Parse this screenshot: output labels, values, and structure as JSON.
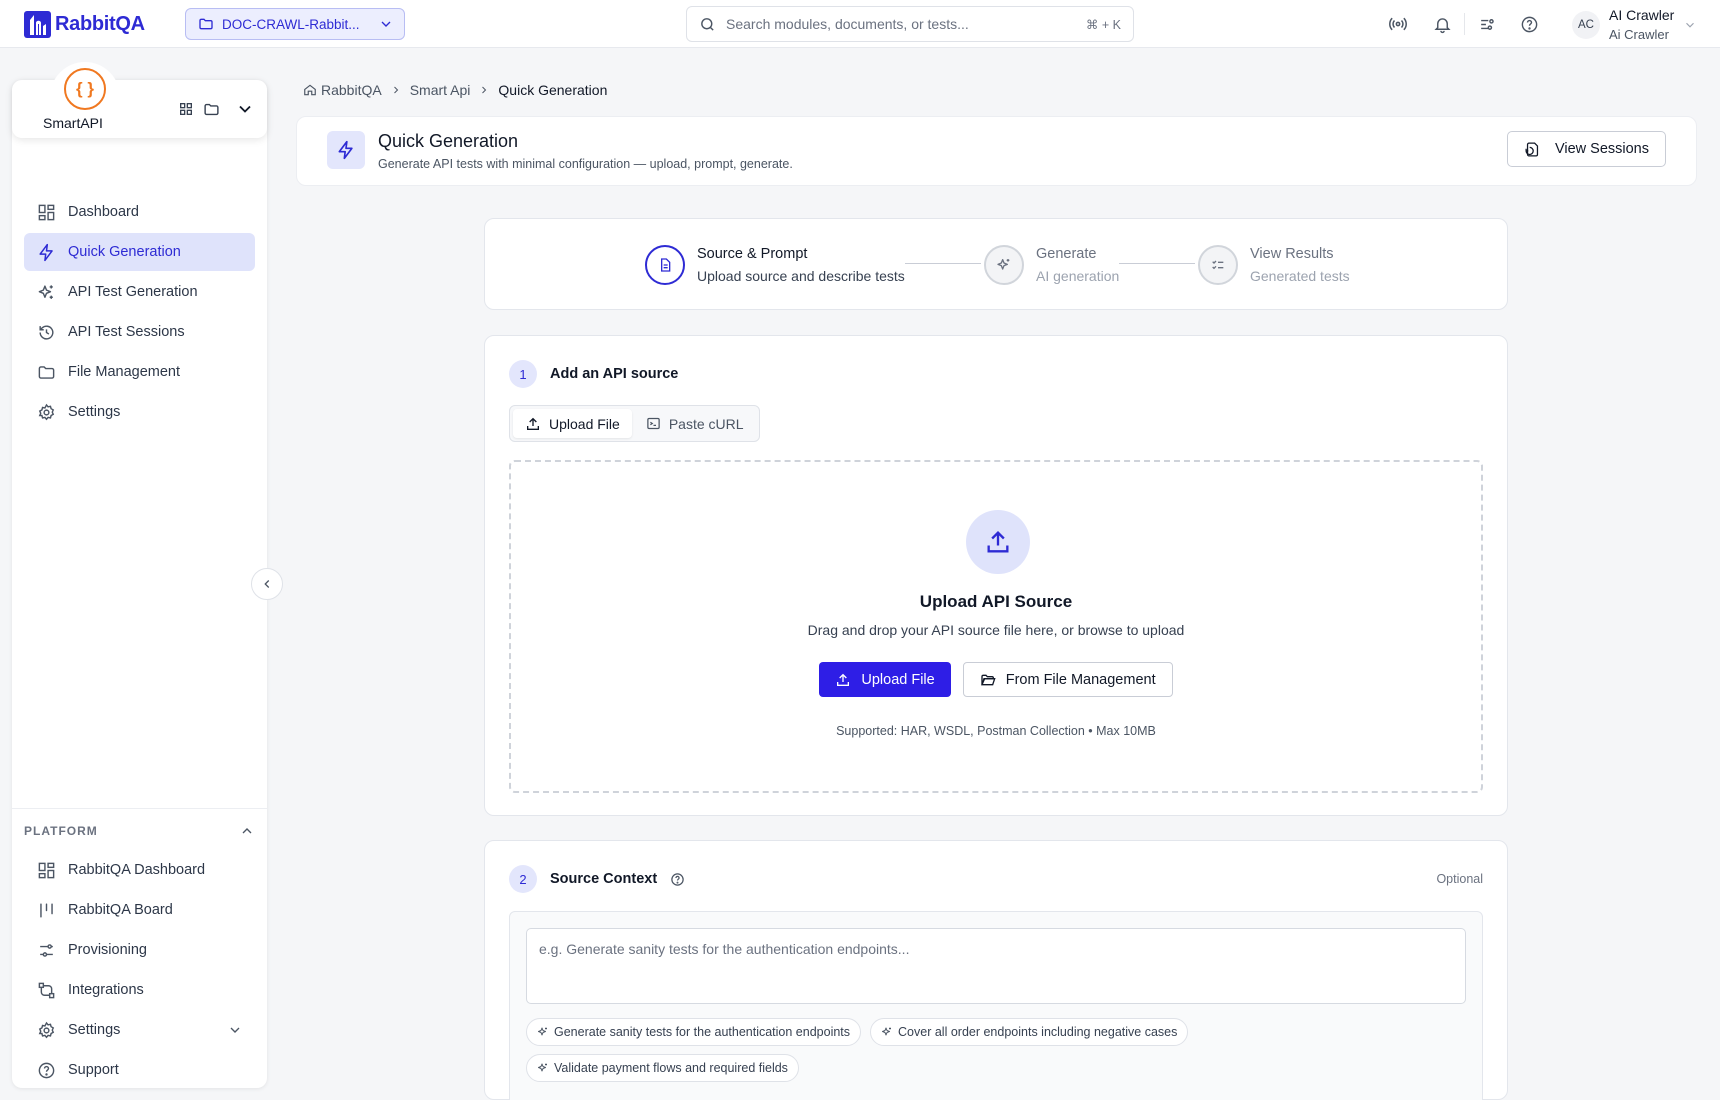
{
  "header": {
    "brand": "RabbitQA",
    "project": "DOC-CRAWL-Rabbit...",
    "search_placeholder": "Search modules, documents, or tests...",
    "search_shortcut": "⌘ + K",
    "user_initials": "AC",
    "user_name": "AI Crawler",
    "user_role": "Ai Crawler"
  },
  "sidebar": {
    "app_name": "SmartAPI",
    "items": [
      {
        "label": "Dashboard",
        "icon": "dashboard-icon"
      },
      {
        "label": "Quick Generation",
        "icon": "bolt-icon",
        "active": true
      },
      {
        "label": "API Test Generation",
        "icon": "sparkles-icon"
      },
      {
        "label": "API Test Sessions",
        "icon": "history-icon"
      },
      {
        "label": "File Management",
        "icon": "folder-icon"
      },
      {
        "label": "Settings",
        "icon": "gear-icon"
      }
    ],
    "platform_title": "PLATFORM",
    "platform_items": [
      {
        "label": "RabbitQA Dashboard",
        "icon": "dashboard-icon"
      },
      {
        "label": "RabbitQA Board",
        "icon": "board-icon"
      },
      {
        "label": "Provisioning",
        "icon": "sliders-icon"
      },
      {
        "label": "Integrations",
        "icon": "integrations-icon"
      },
      {
        "label": "Settings",
        "icon": "gear-icon"
      },
      {
        "label": "Support",
        "icon": "help-icon"
      }
    ]
  },
  "breadcrumb": [
    "RabbitQA",
    "Smart Api",
    "Quick Generation"
  ],
  "page": {
    "title": "Quick Generation",
    "subtitle": "Generate API tests with minimal configuration — upload, prompt, generate.",
    "view_sessions": "View Sessions"
  },
  "steps": [
    {
      "title": "Source & Prompt",
      "desc": "Upload source and describe tests",
      "state": "current"
    },
    {
      "title": "Generate",
      "desc": "AI generation",
      "state": "pending"
    },
    {
      "title": "View Results",
      "desc": "Generated tests",
      "state": "pending"
    }
  ],
  "section1": {
    "number": "1",
    "title": "Add an API source",
    "tab_upload": "Upload File",
    "tab_curl": "Paste cURL",
    "dz_title": "Upload API Source",
    "dz_desc": "Drag and drop your API source file here, or browse to upload",
    "btn_upload": "Upload File",
    "btn_fm": "From File Management",
    "supported": "Supported: HAR, WSDL, Postman Collection • Max 10MB"
  },
  "section2": {
    "number": "2",
    "title": "Source Context",
    "optional": "Optional",
    "placeholder": "e.g. Generate sanity tests for the authentication endpoints...",
    "chips": [
      "Generate sanity tests for the authentication endpoints",
      "Cover all order endpoints including negative cases",
      "Validate payment flows and required fields"
    ]
  },
  "colors": {
    "brand": "#2e2bd4",
    "primary_button": "#2e1ee6",
    "active_nav_bg": "#dfe3fb",
    "app_logo": "#f07820"
  }
}
